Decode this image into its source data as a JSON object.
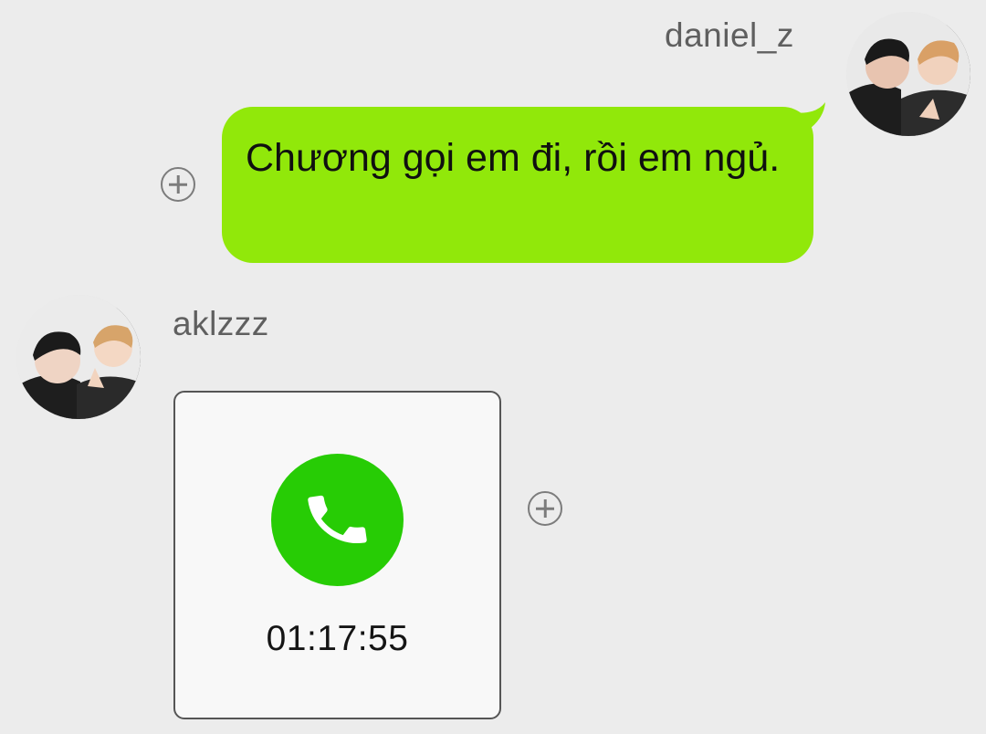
{
  "outgoing": {
    "sender_name": "daniel_z",
    "message_text": "Chương gọi em đi, rồi em ngủ.",
    "bubble_color": "#91e80a",
    "avatar_icon": "profile-photo"
  },
  "incoming": {
    "sender_name": "aklzzz",
    "avatar_icon": "profile-photo",
    "call": {
      "icon": "phone-icon",
      "duration": "01:17:55",
      "accent_color": "#27cc05"
    }
  },
  "actions": {
    "add_icon": "plus-circle-icon"
  },
  "background_color": "#ececec"
}
